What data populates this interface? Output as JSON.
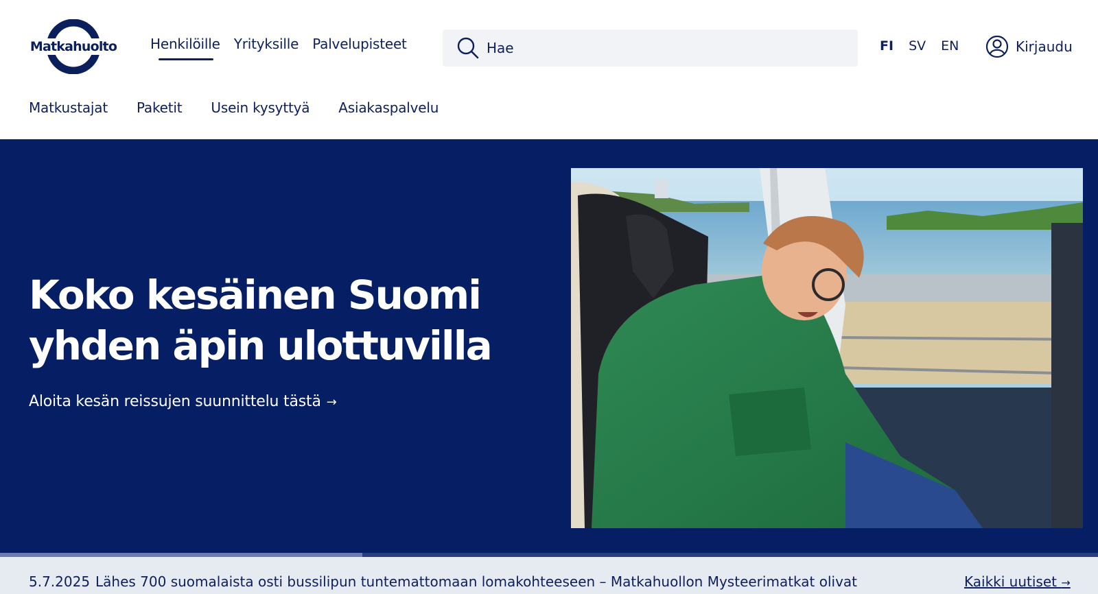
{
  "brand": {
    "logo_text": "Matkahuolto",
    "color_primary": "#061e63"
  },
  "main_nav": [
    {
      "label": "Henkilöille",
      "active": true
    },
    {
      "label": "Yrityksille",
      "active": false
    },
    {
      "label": "Palvelupisteet",
      "active": false
    }
  ],
  "search": {
    "placeholder": "Hae",
    "icon": "search-icon"
  },
  "languages": [
    {
      "label": "FI",
      "active": true
    },
    {
      "label": "SV",
      "active": false
    },
    {
      "label": "EN",
      "active": false
    }
  ],
  "login": {
    "label": "Kirjaudu",
    "icon": "user-circle-icon"
  },
  "sub_nav": [
    {
      "label": "Matkustajat"
    },
    {
      "label": "Paketit"
    },
    {
      "label": "Usein kysyttyä"
    },
    {
      "label": "Asiakaspalvelu"
    }
  ],
  "hero": {
    "title_line1": "Koko kesäinen Suomi",
    "title_line2": "yhden äpin ulottuvilla",
    "link_label": "Aloita kesän reissujen suunnittelu tästä",
    "link_arrow": "→",
    "image_subject": "young man in green shirt sleeping on a bus seat by the window"
  },
  "carousel": {
    "progress_fraction": 0.33
  },
  "news": {
    "date": "5.7.2025",
    "headline": "Lähes 700 suomalaista osti bussilipun tuntemattomaan lomakohteeseen – Matkahuollon Mysteerimatkat olivat",
    "all_news_label": "Kaikki uutiset",
    "all_news_arrow": "→"
  }
}
